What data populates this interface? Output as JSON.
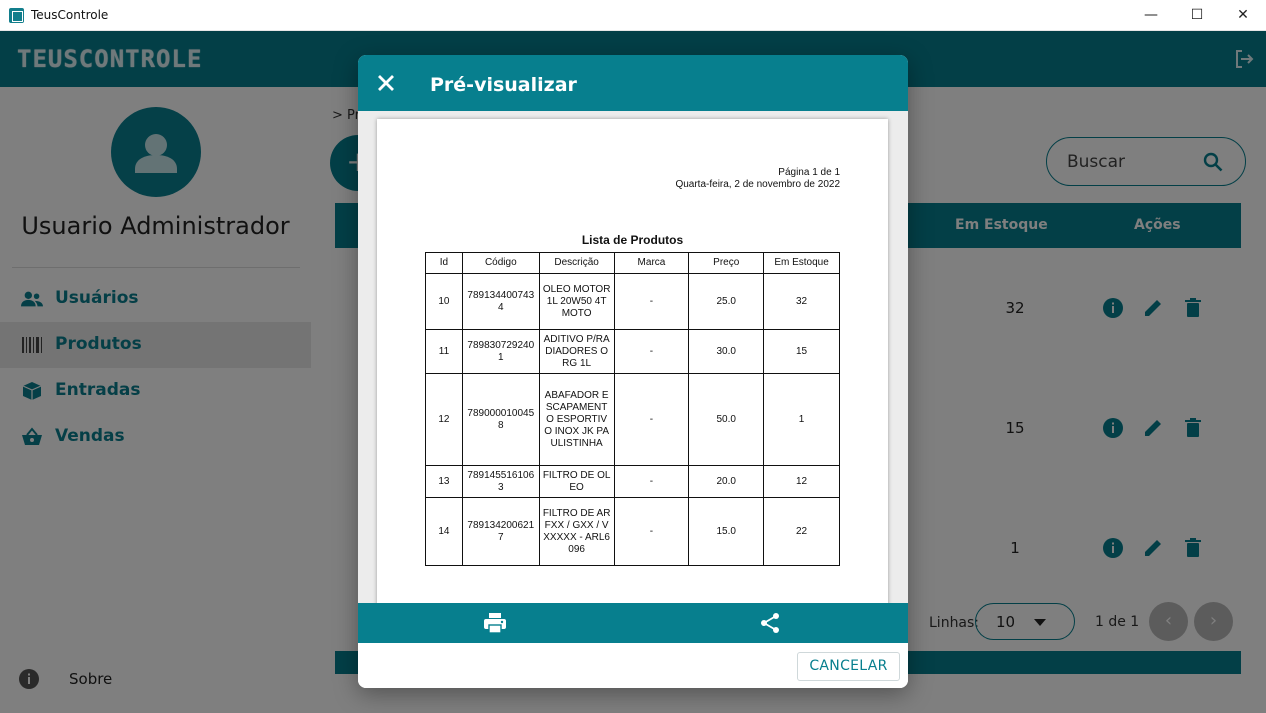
{
  "window": {
    "title": "TeusControle",
    "minimize": "—",
    "maximize": "☐",
    "close": "✕"
  },
  "header": {
    "logo_text": "TEUSCONTROLE",
    "logout_icon": "logout-icon"
  },
  "sidebar": {
    "user_name": "Usuario Administrador",
    "items": [
      {
        "label": "Usuários",
        "icon": "users-icon",
        "active": false
      },
      {
        "label": "Produtos",
        "icon": "barcode-icon",
        "active": true
      },
      {
        "label": "Entradas",
        "icon": "box-icon",
        "active": false
      },
      {
        "label": "Vendas",
        "icon": "basket-icon",
        "active": false
      }
    ],
    "about_label": "Sobre"
  },
  "main": {
    "breadcrumb": "> Pr",
    "add_label": "+",
    "search_placeholder": "Buscar",
    "table_headers": {
      "stock": "Em Estoque",
      "actions": "Ações"
    },
    "rows": [
      {
        "stock": "32"
      },
      {
        "stock": "15"
      },
      {
        "stock": "1"
      }
    ],
    "pagination": {
      "lines_label": "Linhas:",
      "lines_value": "10",
      "page_text": "1 de 1",
      "prev": "‹",
      "next": "›"
    }
  },
  "dialog": {
    "title": "Pré-visualizar",
    "cancel_label": "CANCELAR",
    "report": {
      "page_label": "Página 1 de 1",
      "date_label": "Quarta-feira, 2 de novembro de 2022",
      "title": "Lista de Produtos",
      "headers": [
        "Id",
        "Código",
        "Descrição",
        "Marca",
        "Preço",
        "Em Estoque"
      ],
      "rows": [
        [
          "10",
          "7891344007434",
          "OLEO MOTOR 1L 20W50 4T MOTO",
          "-",
          "25.0",
          "32"
        ],
        [
          "11",
          "7898307292401",
          "ADITIVO P/RADIADORES ORG 1L",
          "-",
          "30.0",
          "15"
        ],
        [
          "12",
          "7890000100458",
          "ABAFADOR ESCAPAMENTO ESPORTIVO INOX JK PAULISTINHA",
          "-",
          "50.0",
          "1"
        ],
        [
          "13",
          "7891455161063",
          "FILTRO DE OLEO",
          "-",
          "20.0",
          "12"
        ],
        [
          "14",
          "7891342006217",
          "FILTRO DE AR FXX / GXX / VXXXXX - ARL6096",
          "-",
          "15.0",
          "22"
        ]
      ]
    }
  },
  "colors": {
    "brand": "#077f8e",
    "overlay": "rgba(0,0,0,0.5)"
  }
}
